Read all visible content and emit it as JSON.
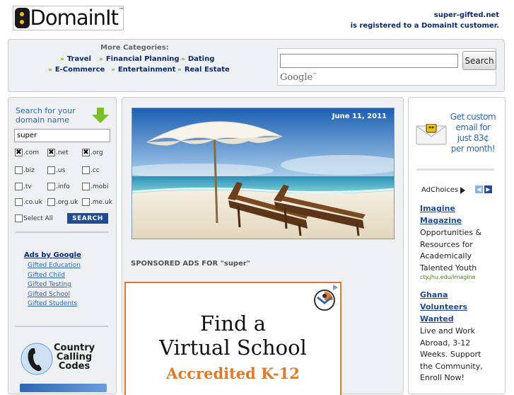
{
  "header": {
    "logo_text": "DomainIt",
    "logo_tm": "™",
    "registration": [
      "super-gifted.net",
      "is registered to a DomainIt customer."
    ]
  },
  "categories": {
    "title": "More Categories:",
    "items": [
      "Travel",
      "Financial Planning",
      "Dating",
      "E-Commerce",
      "Entertainment",
      "Real Estate"
    ]
  },
  "search": {
    "value": "",
    "button_label": "Search",
    "provider": "Google",
    "provider_tm": "™"
  },
  "domain_search": {
    "title": "Search for your domain name",
    "value": "super",
    "tlds": [
      {
        "label": ".com",
        "checked": true
      },
      {
        "label": ".net",
        "checked": true
      },
      {
        "label": ".org",
        "checked": true
      },
      {
        "label": ".biz",
        "checked": false
      },
      {
        "label": ".us",
        "checked": false
      },
      {
        "label": ".cc",
        "checked": false
      },
      {
        "label": ".tv",
        "checked": false
      },
      {
        "label": ".info",
        "checked": false
      },
      {
        "label": ".mobi",
        "checked": false
      },
      {
        "label": ".co.uk",
        "checked": false
      },
      {
        "label": ".org.uk",
        "checked": false
      },
      {
        "label": ".me.uk",
        "checked": false
      }
    ],
    "select_all_label": "Select All",
    "button_label": "SEARCH"
  },
  "ads_by_google": {
    "title": "Ads by Google",
    "links": [
      "Gifted Education",
      "Gifted Child",
      "Gifted Testing",
      "Gifted School",
      "Gifted Students"
    ]
  },
  "country_codes": {
    "lines": [
      "Country",
      "Calling",
      "Codes"
    ]
  },
  "main": {
    "date": "June 11, 2011",
    "sponsored_label": "SPONSORED ADS FOR \"super\"",
    "ad_headline": [
      "Find a",
      "Virtual School"
    ],
    "ad_subheadline": "Accredited K-12"
  },
  "right": {
    "promo_lines": [
      "Get custom",
      "email for",
      "just 83¢",
      "per month!"
    ],
    "adchoices_label": "AdChoices",
    "ads": [
      {
        "title": [
          "Imagine",
          "Magazine"
        ],
        "description": [
          "Opportunities &",
          "Resources for",
          "Academically",
          "Talented Youth"
        ],
        "url": "cty.jhu.edu/imagine"
      },
      {
        "title": [
          "Ghana",
          "Volunteers",
          "Wanted"
        ],
        "description": [
          "Live and Work",
          "Abroad, 3-12",
          "Weeks. Support",
          "the Community,",
          "Enroll Now!"
        ],
        "url": ""
      }
    ]
  },
  "colors": {
    "navy": "#0b2a6f",
    "link_blue": "#2f67b1",
    "accent_orange": "#e07a2b",
    "panel_bg": "#eef0f3",
    "green": "#3a8a0f"
  }
}
